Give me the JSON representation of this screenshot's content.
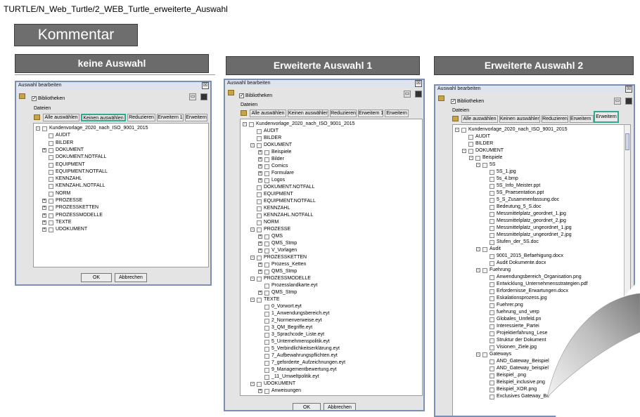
{
  "page": {
    "path": "TURTLE/N_Web_Turtle/2_WEB_Turtle_erweiterte_Auswahl",
    "kommentar": "Kommentar",
    "headers": [
      "keine Auswahl",
      "Erweiterte Auswahl 1",
      "Erweiterte Auswahl 2"
    ]
  },
  "colors": {
    "highlight": "#2faa8f",
    "header_bg": "#6b6b6b",
    "dialog_border": "#7b8fb5"
  },
  "dialog": {
    "title": "Auswahl bearbeiten",
    "close": "☒",
    "checkbox_label": "Bibliotheken",
    "group_label": "Dateien",
    "buttons": {
      "all": "Alle auswählen",
      "none": "Keinen auswählen",
      "reduce": "Reduzieren",
      "expand1": "Erweitern 1",
      "expand": "Erweitern"
    },
    "ok": "OK",
    "cancel": "Abbrechen"
  },
  "trees": {
    "left": [
      {
        "t": "Kundenvorlage_2020_nach_ISO_9001_2015",
        "l": 0,
        "g": "-"
      },
      {
        "t": "AUDIT",
        "l": 1,
        "g": ""
      },
      {
        "t": "BILDER",
        "l": 1,
        "g": ""
      },
      {
        "t": "DOKUMENT",
        "l": 1,
        "g": "+"
      },
      {
        "t": "DOKUMENT.NOTFALL",
        "l": 1,
        "g": ""
      },
      {
        "t": "EQUIPMENT",
        "l": 1,
        "g": ""
      },
      {
        "t": "EQUIPMENT.NOTFALL",
        "l": 1,
        "g": ""
      },
      {
        "t": "KENNZAHL",
        "l": 1,
        "g": ""
      },
      {
        "t": "KENNZAHL.NOTFALL",
        "l": 1,
        "g": ""
      },
      {
        "t": "NORM",
        "l": 1,
        "g": ""
      },
      {
        "t": "PROZESSE",
        "l": 1,
        "g": "+"
      },
      {
        "t": "PROZESSKETTEN",
        "l": 1,
        "g": "+"
      },
      {
        "t": "PROZESSMODELLE",
        "l": 1,
        "g": "+"
      },
      {
        "t": "TEXTE",
        "l": 1,
        "g": "+"
      },
      {
        "t": "UDOKUMENT",
        "l": 1,
        "g": "+"
      }
    ],
    "middle": [
      {
        "t": "Kundenvorlage_2020_nach_ISO_9001_2015",
        "l": 0,
        "g": "-"
      },
      {
        "t": "AUDIT",
        "l": 1,
        "g": ""
      },
      {
        "t": "BILDER",
        "l": 1,
        "g": ""
      },
      {
        "t": "DOKUMENT",
        "l": 1,
        "g": "-"
      },
      {
        "t": "Beispiele",
        "l": 2,
        "g": "+"
      },
      {
        "t": "Bilder",
        "l": 2,
        "g": "+"
      },
      {
        "t": "Comics",
        "l": 2,
        "g": "+"
      },
      {
        "t": "Formulare",
        "l": 2,
        "g": "+"
      },
      {
        "t": "Logos",
        "l": 2,
        "g": "+"
      },
      {
        "t": "DOKUMENT.NOTFALL",
        "l": 1,
        "g": ""
      },
      {
        "t": "EQUIPMENT",
        "l": 1,
        "g": ""
      },
      {
        "t": "EQUIPMENT.NOTFALL",
        "l": 1,
        "g": ""
      },
      {
        "t": "KENNZAHL",
        "l": 1,
        "g": ""
      },
      {
        "t": "KENNZAHL.NOTFALL",
        "l": 1,
        "g": ""
      },
      {
        "t": "NORM",
        "l": 1,
        "g": ""
      },
      {
        "t": "PROZESSE",
        "l": 1,
        "g": "-"
      },
      {
        "t": "QMS",
        "l": 2,
        "g": "+"
      },
      {
        "t": "QMS_Stmp",
        "l": 2,
        "g": "+"
      },
      {
        "t": "V_Vorlagen",
        "l": 2,
        "g": "+"
      },
      {
        "t": "PROZESSKETTEN",
        "l": 1,
        "g": "-"
      },
      {
        "t": "Prozess_Ketten",
        "l": 2,
        "g": "+"
      },
      {
        "t": "QMS_Stmp",
        "l": 2,
        "g": "+"
      },
      {
        "t": "PROZESSMODELLE",
        "l": 1,
        "g": "-"
      },
      {
        "t": "Prozesslandkarte.eyt",
        "l": 2,
        "g": ""
      },
      {
        "t": "QMS_Stmp",
        "l": 2,
        "g": "+"
      },
      {
        "t": "TEXTE",
        "l": 1,
        "g": "-"
      },
      {
        "t": "0_Vorwort.eyt",
        "l": 2,
        "g": ""
      },
      {
        "t": "1_Anwendungsbereich.eyt",
        "l": 2,
        "g": ""
      },
      {
        "t": "2_Normenverweise.eyt",
        "l": 2,
        "g": ""
      },
      {
        "t": "3_QM_Begriffe.eyt",
        "l": 2,
        "g": ""
      },
      {
        "t": "3_Sprachcode_Liste.eyt",
        "l": 2,
        "g": ""
      },
      {
        "t": "5_Unternehmenspolitik.eyt",
        "l": 2,
        "g": ""
      },
      {
        "t": "5_Verbindlichkeitserklärung.eyt",
        "l": 2,
        "g": ""
      },
      {
        "t": "7_Aufbewahrungspflichten.eyt",
        "l": 2,
        "g": ""
      },
      {
        "t": "7_geforderte_Aufzeichnungen.eyt",
        "l": 2,
        "g": ""
      },
      {
        "t": "9_Managementbewertung.eyt",
        "l": 2,
        "g": ""
      },
      {
        "t": "_11_Umweltpolitik.eyt",
        "l": 2,
        "g": ""
      },
      {
        "t": "UDOKUMENT",
        "l": 1,
        "g": "-"
      },
      {
        "t": "Anweisungen",
        "l": 2,
        "g": "+"
      }
    ],
    "right": [
      {
        "t": "Kundenvorlage_2020_nach_ISO_9001_2015",
        "l": 0,
        "g": "-"
      },
      {
        "t": "AUDIT",
        "l": 1,
        "g": ""
      },
      {
        "t": "BILDER",
        "l": 1,
        "g": ""
      },
      {
        "t": "DOKUMENT",
        "l": 1,
        "g": "-"
      },
      {
        "t": "Beispiele",
        "l": 2,
        "g": "-"
      },
      {
        "t": "5S",
        "l": 3,
        "g": "-"
      },
      {
        "t": "5S_1.jpg",
        "l": 4,
        "g": ""
      },
      {
        "t": "5s_4.bmp",
        "l": 4,
        "g": ""
      },
      {
        "t": "5S_Info_Meister.ppt",
        "l": 4,
        "g": ""
      },
      {
        "t": "5S_Praesentation.ppt",
        "l": 4,
        "g": ""
      },
      {
        "t": "5_S_Zusammenfassung.doc",
        "l": 4,
        "g": ""
      },
      {
        "t": "Bedeutung_5_S.doc",
        "l": 4,
        "g": ""
      },
      {
        "t": "Messmittelplatz_geordnet_1.jpg",
        "l": 4,
        "g": ""
      },
      {
        "t": "Messmittelplatz_geordnet_2.jpg",
        "l": 4,
        "g": ""
      },
      {
        "t": "Messmittelplatz_ungeordnet_1.jpg",
        "l": 4,
        "g": ""
      },
      {
        "t": "Messmittelplatz_ungeordnet_2.jpg",
        "l": 4,
        "g": ""
      },
      {
        "t": "Stufen_der_5S.doc",
        "l": 4,
        "g": ""
      },
      {
        "t": "Audit",
        "l": 3,
        "g": "-"
      },
      {
        "t": "9001_2015_Befaehigung.docx",
        "l": 4,
        "g": ""
      },
      {
        "t": "Audit Dokumente.docx",
        "l": 4,
        "g": ""
      },
      {
        "t": "Fuehrung",
        "l": 3,
        "g": "-"
      },
      {
        "t": "Anwendungsbereich_Organisation.png",
        "l": 4,
        "g": ""
      },
      {
        "t": "Entwicklung_Unternehmensstrategien.pdf",
        "l": 4,
        "g": ""
      },
      {
        "t": "Erfordernisse_Erwartungen.docx",
        "l": 4,
        "g": ""
      },
      {
        "t": "Eskalationsprozess.jpg",
        "l": 4,
        "g": ""
      },
      {
        "t": "Fuehrer.png",
        "l": 4,
        "g": ""
      },
      {
        "t": "fuehrung_und_verp",
        "l": 4,
        "g": ""
      },
      {
        "t": "Globales_Umfeld.pn",
        "l": 4,
        "g": ""
      },
      {
        "t": "Interessierte_Partei",
        "l": 4,
        "g": ""
      },
      {
        "t": "Projektierfahrung_Lese",
        "l": 4,
        "g": ""
      },
      {
        "t": "Struktur der Dokument",
        "l": 4,
        "g": ""
      },
      {
        "t": "Visionen_Ziele.jpg",
        "l": 4,
        "g": ""
      },
      {
        "t": "Gateways",
        "l": 3,
        "g": "-"
      },
      {
        "t": "AND_Gateway_Beispiel",
        "l": 4,
        "g": ""
      },
      {
        "t": "AND_Gateway_beispiel",
        "l": 4,
        "g": ""
      },
      {
        "t": "Beispiel_.png",
        "l": 4,
        "g": ""
      },
      {
        "t": "Beispiel_inclusive.png",
        "l": 4,
        "g": ""
      },
      {
        "t": "Beispiel_XOR.png",
        "l": 4,
        "g": ""
      },
      {
        "t": "Exclusives Gateway_Be",
        "l": 4,
        "g": ""
      }
    ]
  }
}
